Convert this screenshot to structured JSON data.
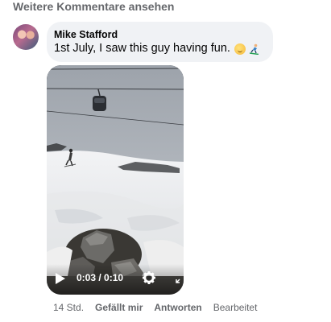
{
  "thread": {
    "more_comments_label": "Weitere Kommentare ansehen"
  },
  "comment": {
    "author": "Mike Stafford",
    "text": "1st July, I saw this guy having fun.",
    "emojis": [
      "slightly-smiling-face-emoji",
      "skier-emoji"
    ],
    "video": {
      "time": "0:03 / 0:10",
      "progress": 0.3,
      "icons": [
        "play-icon",
        "gear-icon",
        "expand-icon"
      ]
    },
    "meta": {
      "age": "14 Std.",
      "like_label": "Gefällt mir",
      "reply_label": "Antworten",
      "edited_label": "Bearbeitet"
    }
  },
  "colors": {
    "bubble_bg": "#f0f2f5",
    "secondary_text": "#65676b",
    "primary_text": "#050505"
  }
}
